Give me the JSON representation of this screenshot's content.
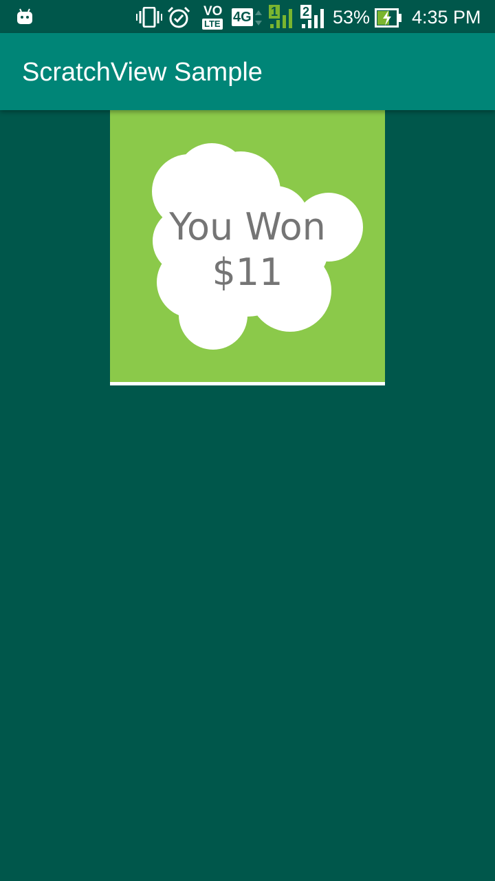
{
  "status_bar": {
    "icons": [
      "android-icon",
      "vibrate-icon",
      "alarm-icon",
      "volte-icon",
      "4g-icon",
      "sim1-signal-icon",
      "sim2-signal-icon",
      "battery-charging-icon"
    ],
    "volte_top": "VO",
    "volte_bottom": "LTE",
    "network": "4G",
    "sim1": "1",
    "sim2": "2",
    "battery": "53%",
    "time": "4:35 PM"
  },
  "app_bar": {
    "title": "ScratchView Sample"
  },
  "scratch_card": {
    "prize_line_1": "You Won",
    "prize_line_2": "$11",
    "overlay_color": "#8bc94a",
    "revealed_color": "#ffffff"
  },
  "colors": {
    "status_bar": "#00574b",
    "app_bar": "#008577",
    "background": "#00574b",
    "prize_text": "#757575"
  }
}
